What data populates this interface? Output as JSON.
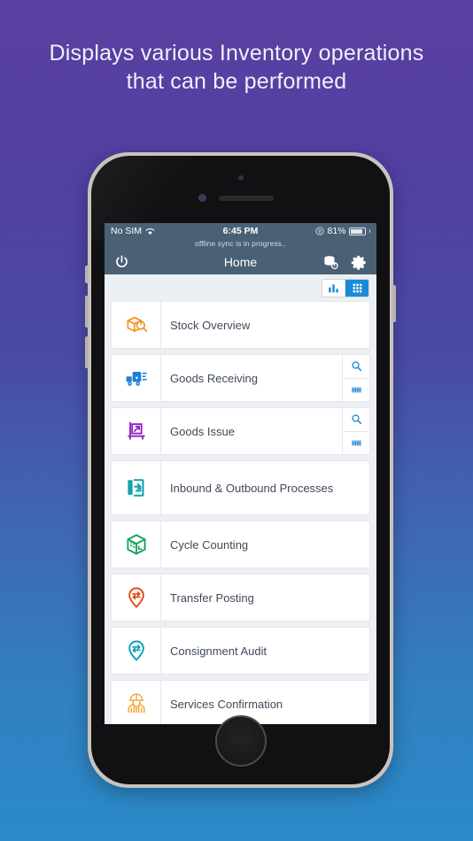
{
  "headline": {
    "line1": "Displays various Inventory operations",
    "line2": "that can be performed"
  },
  "colors": {
    "bg_top": "#5a3fa0",
    "bg_bottom": "#2a8ac8",
    "navbar": "#4a6075",
    "accent_blue": "#1b8ad6",
    "text": "#3f4a5a"
  },
  "status_bar": {
    "carrier": "No SIM",
    "wifi_icon": "wifi-icon",
    "time": "6:45 PM",
    "rotation_lock_icon": "rotation-lock-icon",
    "battery_percent": "81%",
    "battery_icon": "battery-icon"
  },
  "sync_banner": {
    "text": "offline sync is in progress.."
  },
  "navbar": {
    "power_icon": "power-icon",
    "title": "Home",
    "sync_icon": "database-sync-icon",
    "settings_icon": "gear-icon"
  },
  "view_toggle": {
    "chart_option": "chart-view-icon",
    "grid_option": "grid-view-icon",
    "selected": "grid"
  },
  "list": {
    "items": [
      {
        "label": "Stock Overview",
        "icon": "box-search-icon",
        "color": "#f0941f",
        "actions": []
      },
      {
        "label": "Goods Receiving",
        "icon": "truck-inbound-icon",
        "color": "#1b7fd4",
        "actions": [
          "search-icon",
          "scan-icon"
        ]
      },
      {
        "label": "Goods Issue",
        "icon": "pallet-outbound-icon",
        "color": "#8e1fc4",
        "actions": [
          "search-icon",
          "scan-icon"
        ]
      },
      {
        "label": "Inbound & Outbound Processes",
        "icon": "door-arrow-icon",
        "color": "#0fa4ae",
        "actions": []
      },
      {
        "label": "Cycle Counting",
        "icon": "cube-count-icon",
        "color": "#13a05c",
        "actions": []
      },
      {
        "label": "Transfer Posting",
        "icon": "pin-transfer-icon",
        "color": "#e04e12",
        "actions": []
      },
      {
        "label": "Consignment Audit",
        "icon": "pin-audit-icon",
        "color": "#0fa0b4",
        "actions": []
      },
      {
        "label": "Services Confirmation",
        "icon": "worker-icon",
        "color": "#f3a63c",
        "actions": []
      }
    ]
  },
  "device": {
    "home_button": "home-button",
    "camera": "front-camera",
    "speaker": "earpiece-speaker"
  }
}
